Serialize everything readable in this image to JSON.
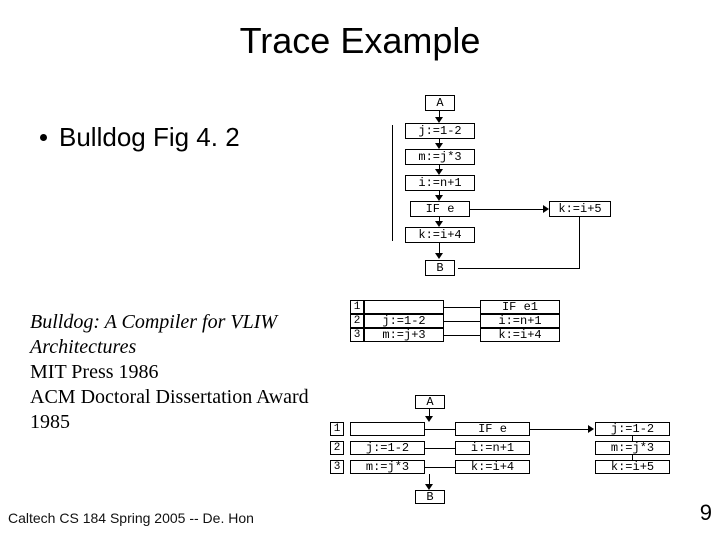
{
  "title": "Trace Example",
  "bullet": "Bulldog Fig 4. 2",
  "citation": {
    "book_title": "Bulldog: A Compiler for VLIW Architectures",
    "line1": "MIT Press 1986",
    "line2": "ACM Doctoral Dissertation Award 1985"
  },
  "footer": "Caltech CS 184 Spring 2005 -- De. Hon",
  "slide_number": "9",
  "diagram1": {
    "A": "A",
    "r1": "j:=1-2",
    "r2": "m:=j*3",
    "r3": "i:=n+1",
    "r4": "IF e",
    "r5": "k:=i+4",
    "B": "B",
    "side": "k:=i+5"
  },
  "diagram2": {
    "n1": "1",
    "n2": "2",
    "n3": "3",
    "c1b": "j:=1-2",
    "c1c": "m:=j+3",
    "c2a": "IF e1",
    "c2b": "i:=n+1",
    "c2c": "k:=i+4"
  },
  "diagram3": {
    "A": "A",
    "B": "B",
    "n1": "1",
    "n2": "2",
    "n3": "3",
    "r2a": "j:=1-2",
    "r3a": "m:=j*3",
    "r1b": "IF e",
    "r2b": "i:=n+1",
    "r3b": "k:=i+4",
    "s1": "j:=1-2",
    "s2": "m:=j*3",
    "s3": "k:=i+5"
  }
}
